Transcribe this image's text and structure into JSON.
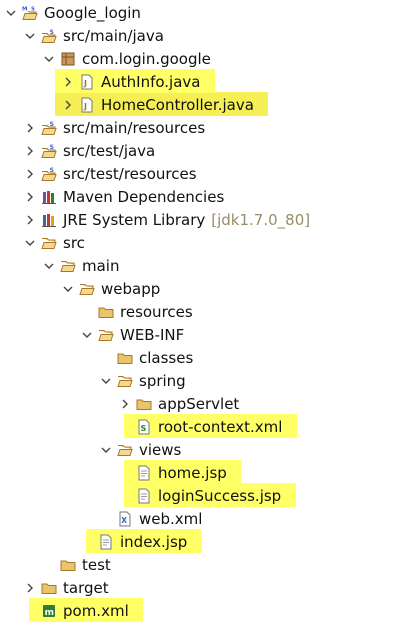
{
  "tree": [
    {
      "id": "google-login",
      "label": "Google_login",
      "icon": "maven-project-icon",
      "level": 0,
      "expanded": true
    },
    {
      "id": "src-main-java",
      "label": "src/main/java",
      "icon": "source-folder-icon",
      "level": 1,
      "expanded": true
    },
    {
      "id": "com-login-google",
      "label": "com.login.google",
      "icon": "package-icon",
      "level": 2,
      "expanded": true
    },
    {
      "id": "authinfo-java",
      "label": "AuthInfo.java",
      "icon": "java-file-icon",
      "level": 3,
      "expanded": false,
      "highlighted": true
    },
    {
      "id": "homecontroller-java",
      "label": "HomeController.java",
      "icon": "java-file-icon",
      "level": 3,
      "expanded": false,
      "highlighted": true,
      "selected": true
    },
    {
      "id": "src-main-resources",
      "label": "src/main/resources",
      "icon": "source-folder-icon",
      "level": 1,
      "expanded": false
    },
    {
      "id": "src-test-java",
      "label": "src/test/java",
      "icon": "source-folder-icon",
      "level": 1,
      "expanded": false
    },
    {
      "id": "src-test-resources",
      "label": "src/test/resources",
      "icon": "source-folder-icon",
      "level": 1,
      "expanded": false
    },
    {
      "id": "maven-dependencies",
      "label": "Maven Dependencies",
      "icon": "library-icon",
      "level": 1,
      "expanded": false
    },
    {
      "id": "jre-system-library",
      "label": "JRE System Library",
      "suffix": "[jdk1.7.0_80]",
      "icon": "jre-library-icon",
      "level": 1,
      "expanded": false
    },
    {
      "id": "src",
      "label": "src",
      "icon": "folder-open-icon",
      "level": 1,
      "expanded": true
    },
    {
      "id": "main",
      "label": "main",
      "icon": "folder-open-icon",
      "level": 2,
      "expanded": true
    },
    {
      "id": "webapp",
      "label": "webapp",
      "icon": "folder-open-icon",
      "level": 3,
      "expanded": true
    },
    {
      "id": "resources",
      "label": "resources",
      "icon": "folder-icon",
      "level": 4,
      "leaf": true
    },
    {
      "id": "web-inf",
      "label": "WEB-INF",
      "icon": "folder-open-icon",
      "level": 4,
      "expanded": true
    },
    {
      "id": "classes",
      "label": "classes",
      "icon": "folder-icon",
      "level": 5,
      "leaf": true
    },
    {
      "id": "spring",
      "label": "spring",
      "icon": "folder-open-icon",
      "level": 5,
      "expanded": true
    },
    {
      "id": "appservlet",
      "label": "appServlet",
      "icon": "folder-icon",
      "level": 6,
      "expanded": false
    },
    {
      "id": "root-context-xml",
      "label": "root-context.xml",
      "icon": "spring-xml-icon",
      "level": 6,
      "leaf": true,
      "highlighted": true
    },
    {
      "id": "views",
      "label": "views",
      "icon": "folder-open-icon",
      "level": 5,
      "expanded": true
    },
    {
      "id": "home-jsp",
      "label": "home.jsp",
      "icon": "jsp-file-icon",
      "level": 6,
      "leaf": true,
      "highlighted": true
    },
    {
      "id": "loginsuccess-jsp",
      "label": "loginSuccess.jsp",
      "icon": "jsp-file-icon",
      "level": 6,
      "leaf": true,
      "highlighted": true
    },
    {
      "id": "web-xml",
      "label": "web.xml",
      "icon": "xml-file-icon",
      "level": 5,
      "leaf": true
    },
    {
      "id": "index-jsp",
      "label": "index.jsp",
      "icon": "jsp-file-icon",
      "level": 4,
      "leaf": true,
      "highlighted": true
    },
    {
      "id": "test",
      "label": "test",
      "icon": "folder-icon",
      "level": 2,
      "leaf": true
    },
    {
      "id": "target",
      "label": "target",
      "icon": "folder-icon",
      "level": 1,
      "expanded": false
    },
    {
      "id": "pom-xml",
      "label": "pom.xml",
      "icon": "maven-pom-icon",
      "level": 1,
      "leaf": true,
      "highlighted": true
    }
  ],
  "colors": {
    "highlight": "#ffff66",
    "selected": "#f5ef55",
    "folder": "#d9a84e",
    "muted": "#9a8b6a"
  }
}
